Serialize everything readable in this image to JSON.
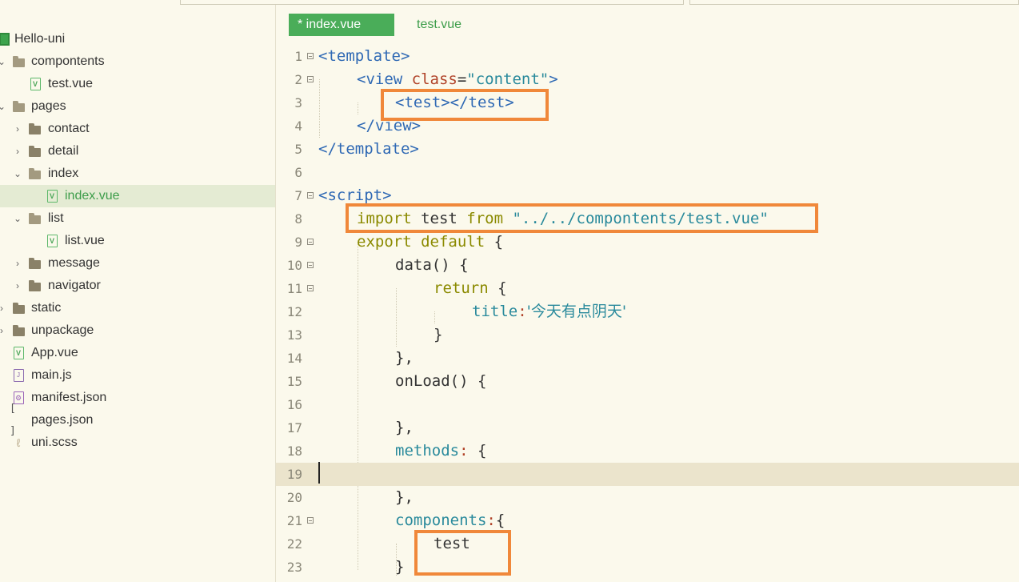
{
  "sidebar": {
    "project": "Hello-uni",
    "items": [
      {
        "label": "compontents",
        "type": "folder-open",
        "chevron": "expanded"
      },
      {
        "label": "test.vue",
        "type": "vue"
      },
      {
        "label": "pages",
        "type": "folder-open",
        "chevron": "expanded"
      },
      {
        "label": "contact",
        "type": "folder",
        "chevron": "collapsed"
      },
      {
        "label": "detail",
        "type": "folder",
        "chevron": "collapsed"
      },
      {
        "label": "index",
        "type": "folder-open",
        "chevron": "expanded"
      },
      {
        "label": "index.vue",
        "type": "vue",
        "selected": true
      },
      {
        "label": "list",
        "type": "folder-open",
        "chevron": "expanded"
      },
      {
        "label": "list.vue",
        "type": "vue"
      },
      {
        "label": "message",
        "type": "folder",
        "chevron": "collapsed"
      },
      {
        "label": "navigator",
        "type": "folder",
        "chevron": "collapsed"
      },
      {
        "label": "static",
        "type": "folder",
        "chevron": "collapsed"
      },
      {
        "label": "unpackage",
        "type": "folder",
        "chevron": "collapsed"
      },
      {
        "label": "App.vue",
        "type": "vue"
      },
      {
        "label": "main.js",
        "type": "js"
      },
      {
        "label": "manifest.json",
        "type": "json"
      },
      {
        "label": "pages.json",
        "type": "brackets"
      },
      {
        "label": "uni.scss",
        "type": "scss"
      }
    ]
  },
  "tabs": {
    "active": "* index.vue",
    "other": "test.vue"
  },
  "editor": {
    "line_numbers": [
      "1",
      "2",
      "3",
      "4",
      "5",
      "6",
      "7",
      "8",
      "9",
      "10",
      "11",
      "12",
      "13",
      "14",
      "15",
      "16",
      "17",
      "18",
      "19",
      "20",
      "21",
      "22",
      "23"
    ],
    "code": {
      "l1_tag": "<template>",
      "l2_open": "<view ",
      "l2_attr": "class",
      "l2_eq": "=",
      "l2_str": "\"content\"",
      "l2_close": ">",
      "l3_tag": "<test></test>",
      "l4_tag": "</view>",
      "l5_tag": "</template>",
      "l7_tag": "<script>",
      "l8_import": "import",
      "l8_name": " test ",
      "l8_from": "from",
      "l8_path": " \"../../compontents/test.vue\"",
      "l9_export": "export default",
      "l9_brace": " {",
      "l10": "data() {",
      "l11_return": "return",
      "l11_brace": " {",
      "l12_key": "title",
      "l12_colon": ":",
      "l12_val": "'今天有点阴天'",
      "l13": "}",
      "l14": "},",
      "l15": "onLoad() {",
      "l17": "},",
      "l18_key": "methods",
      "l18_colon": ":",
      "l18_brace": " {",
      "l20": "},",
      "l21_key": "components",
      "l21_colon": ":",
      "l21_brace": "{",
      "l22": "test",
      "l23": "}"
    }
  },
  "colors": {
    "background": "#fbf9ec",
    "tab_active": "#4aad59",
    "highlight_box": "#f0883a",
    "tag": "#2f69b4",
    "string": "#2a8a9c",
    "keyword": "#8b8a00"
  }
}
